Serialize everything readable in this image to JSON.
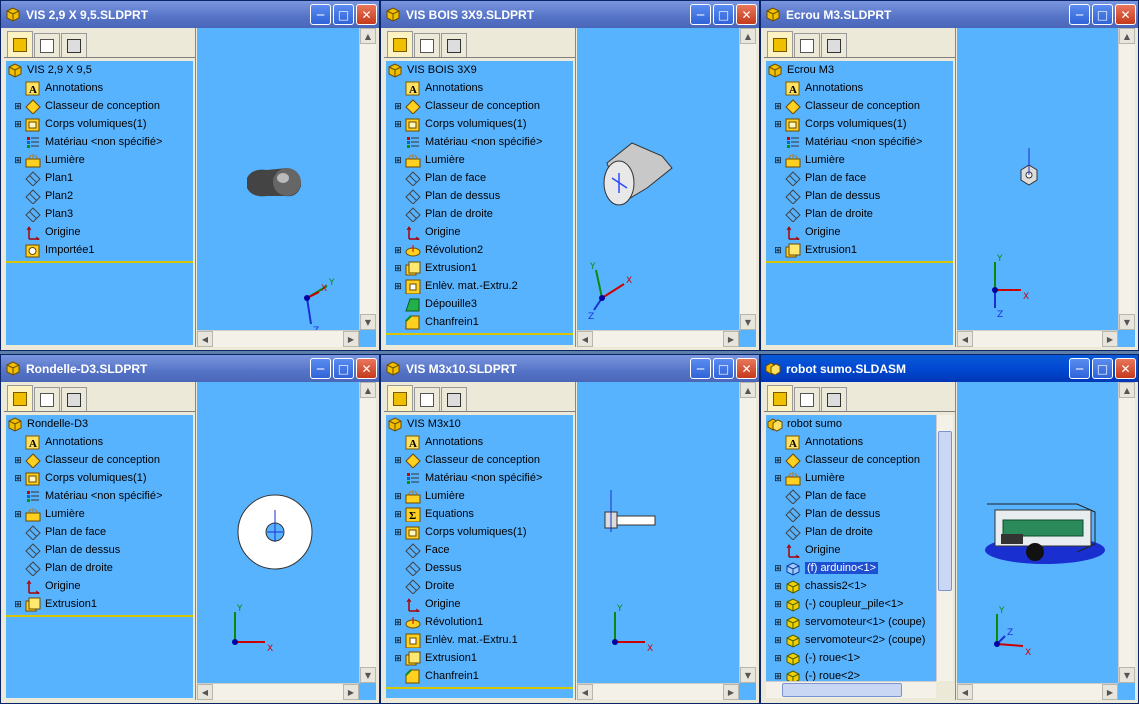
{
  "windows": [
    {
      "title": "VIS 2,9 X 9,5.SLDPRT",
      "tree": [
        {
          "label": "VIS 2,9 X 9,5",
          "icon": "part-icon",
          "exp": "none",
          "root": true
        },
        {
          "label": "Annotations",
          "icon": "annotation-icon",
          "exp": "none"
        },
        {
          "label": "Classeur de conception",
          "icon": "design-binder-icon",
          "exp": "plus"
        },
        {
          "label": "Corps volumiques(1)",
          "icon": "solid-bodies-icon",
          "exp": "plus"
        },
        {
          "label": "Matériau <non spécifié>",
          "icon": "material-icon",
          "exp": "none"
        },
        {
          "label": "Lumière",
          "icon": "lighting-icon",
          "exp": "plus"
        },
        {
          "label": "Plan1",
          "icon": "plane-icon",
          "exp": "none"
        },
        {
          "label": "Plan2",
          "icon": "plane-icon",
          "exp": "none"
        },
        {
          "label": "Plan3",
          "icon": "plane-icon",
          "exp": "none"
        },
        {
          "label": "Origine",
          "icon": "origin-icon",
          "exp": "none"
        },
        {
          "label": "Importée1",
          "icon": "imported-feature-icon",
          "exp": "none"
        }
      ]
    },
    {
      "title": "VIS BOIS 3X9.SLDPRT",
      "tree": [
        {
          "label": "VIS BOIS 3X9",
          "icon": "part-icon",
          "exp": "none",
          "root": true
        },
        {
          "label": "Annotations",
          "icon": "annotation-icon",
          "exp": "none"
        },
        {
          "label": "Classeur de conception",
          "icon": "design-binder-icon",
          "exp": "plus"
        },
        {
          "label": "Corps volumiques(1)",
          "icon": "solid-bodies-icon",
          "exp": "plus"
        },
        {
          "label": "Matériau <non spécifié>",
          "icon": "material-icon",
          "exp": "none"
        },
        {
          "label": "Lumière",
          "icon": "lighting-icon",
          "exp": "plus"
        },
        {
          "label": "Plan de face",
          "icon": "plane-icon",
          "exp": "none"
        },
        {
          "label": "Plan de dessus",
          "icon": "plane-icon",
          "exp": "none"
        },
        {
          "label": "Plan de droite",
          "icon": "plane-icon",
          "exp": "none"
        },
        {
          "label": "Origine",
          "icon": "origin-icon",
          "exp": "none"
        },
        {
          "label": "Révolution2",
          "icon": "revolve-icon",
          "exp": "plus"
        },
        {
          "label": "Extrusion1",
          "icon": "extrude-icon",
          "exp": "plus"
        },
        {
          "label": "Enlèv. mat.-Extru.2",
          "icon": "cut-extrude-icon",
          "exp": "plus"
        },
        {
          "label": "Dépouille3",
          "icon": "draft-icon",
          "exp": "none"
        },
        {
          "label": "Chanfrein1",
          "icon": "chamfer-icon",
          "exp": "none"
        }
      ]
    },
    {
      "title": "Ecrou M3.SLDPRT",
      "tree": [
        {
          "label": "Ecrou M3",
          "icon": "part-icon",
          "exp": "none",
          "root": true
        },
        {
          "label": "Annotations",
          "icon": "annotation-icon",
          "exp": "none"
        },
        {
          "label": "Classeur de conception",
          "icon": "design-binder-icon",
          "exp": "plus"
        },
        {
          "label": "Corps volumiques(1)",
          "icon": "solid-bodies-icon",
          "exp": "plus"
        },
        {
          "label": "Matériau <non spécifié>",
          "icon": "material-icon",
          "exp": "none"
        },
        {
          "label": "Lumière",
          "icon": "lighting-icon",
          "exp": "plus"
        },
        {
          "label": "Plan de face",
          "icon": "plane-icon",
          "exp": "none"
        },
        {
          "label": "Plan de dessus",
          "icon": "plane-icon",
          "exp": "none"
        },
        {
          "label": "Plan de droite",
          "icon": "plane-icon",
          "exp": "none"
        },
        {
          "label": "Origine",
          "icon": "origin-icon",
          "exp": "none"
        },
        {
          "label": "Extrusion1",
          "icon": "extrude-icon",
          "exp": "plus"
        }
      ]
    },
    {
      "title": "Rondelle-D3.SLDPRT",
      "tree": [
        {
          "label": "Rondelle-D3",
          "icon": "part-icon",
          "exp": "none",
          "root": true
        },
        {
          "label": "Annotations",
          "icon": "annotation-icon",
          "exp": "none"
        },
        {
          "label": "Classeur de conception",
          "icon": "design-binder-icon",
          "exp": "plus"
        },
        {
          "label": "Corps volumiques(1)",
          "icon": "solid-bodies-icon",
          "exp": "plus"
        },
        {
          "label": "Matériau <non spécifié>",
          "icon": "material-icon",
          "exp": "none"
        },
        {
          "label": "Lumière",
          "icon": "lighting-icon",
          "exp": "plus"
        },
        {
          "label": "Plan de face",
          "icon": "plane-icon",
          "exp": "none"
        },
        {
          "label": "Plan de dessus",
          "icon": "plane-icon",
          "exp": "none"
        },
        {
          "label": "Plan de droite",
          "icon": "plane-icon",
          "exp": "none"
        },
        {
          "label": "Origine",
          "icon": "origin-icon",
          "exp": "none"
        },
        {
          "label": "Extrusion1",
          "icon": "extrude-icon",
          "exp": "plus"
        }
      ]
    },
    {
      "title": "VIS M3x10.SLDPRT",
      "tree": [
        {
          "label": "VIS M3x10",
          "icon": "part-icon",
          "exp": "none",
          "root": true
        },
        {
          "label": "Annotations",
          "icon": "annotation-icon",
          "exp": "none"
        },
        {
          "label": "Classeur de conception",
          "icon": "design-binder-icon",
          "exp": "plus"
        },
        {
          "label": "Matériau <non spécifié>",
          "icon": "material-icon",
          "exp": "none"
        },
        {
          "label": "Lumière",
          "icon": "lighting-icon",
          "exp": "plus"
        },
        {
          "label": "Equations",
          "icon": "equations-icon",
          "exp": "plus"
        },
        {
          "label": "Corps volumiques(1)",
          "icon": "solid-bodies-icon",
          "exp": "plus"
        },
        {
          "label": "Face",
          "icon": "plane-icon",
          "exp": "none"
        },
        {
          "label": "Dessus",
          "icon": "plane-icon",
          "exp": "none"
        },
        {
          "label": "Droite",
          "icon": "plane-icon",
          "exp": "none"
        },
        {
          "label": "Origine",
          "icon": "origin-icon",
          "exp": "none"
        },
        {
          "label": "Révolution1",
          "icon": "revolve-icon",
          "exp": "plus"
        },
        {
          "label": "Enlèv. mat.-Extru.1",
          "icon": "cut-extrude-icon",
          "exp": "plus"
        },
        {
          "label": "Extrusion1",
          "icon": "extrude-icon",
          "exp": "plus"
        },
        {
          "label": "Chanfrein1",
          "icon": "chamfer-icon",
          "exp": "none"
        }
      ]
    },
    {
      "title": "robot sumo.SLDASM",
      "tree": [
        {
          "label": "robot sumo",
          "icon": "assembly-icon",
          "exp": "none",
          "root": true
        },
        {
          "label": "Annotations",
          "icon": "annotation-icon",
          "exp": "none"
        },
        {
          "label": "Classeur de conception",
          "icon": "design-binder-icon",
          "exp": "plus"
        },
        {
          "label": "Lumière",
          "icon": "lighting-icon",
          "exp": "plus"
        },
        {
          "label": "Plan de face",
          "icon": "plane-icon",
          "exp": "none"
        },
        {
          "label": "Plan de dessus",
          "icon": "plane-icon",
          "exp": "none"
        },
        {
          "label": "Plan de droite",
          "icon": "plane-icon",
          "exp": "none"
        },
        {
          "label": "Origine",
          "icon": "origin-icon",
          "exp": "none"
        },
        {
          "label": "(f) arduino<1>",
          "icon": "component-icon",
          "exp": "plus",
          "hl": true
        },
        {
          "label": "chassis2<1>",
          "icon": "subassembly-icon",
          "exp": "plus"
        },
        {
          "label": "(-) coupleur_pile<1>",
          "icon": "subassembly-icon",
          "exp": "plus"
        },
        {
          "label": "servomoteur<1> (coupe)",
          "icon": "subassembly-icon",
          "exp": "plus"
        },
        {
          "label": "servomoteur<2> (coupe)",
          "icon": "subassembly-icon",
          "exp": "plus"
        },
        {
          "label": "(-) roue<1>",
          "icon": "subassembly-icon",
          "exp": "plus"
        },
        {
          "label": "(-) roue<2>",
          "icon": "subassembly-icon",
          "exp": "plus"
        }
      ]
    }
  ],
  "axis_labels": {
    "x": "X",
    "y": "Y",
    "z": "Z"
  },
  "colors": {
    "viewport": "#58b3ff",
    "title_active": "#0047d0",
    "title_inactive": "#5573c6"
  }
}
